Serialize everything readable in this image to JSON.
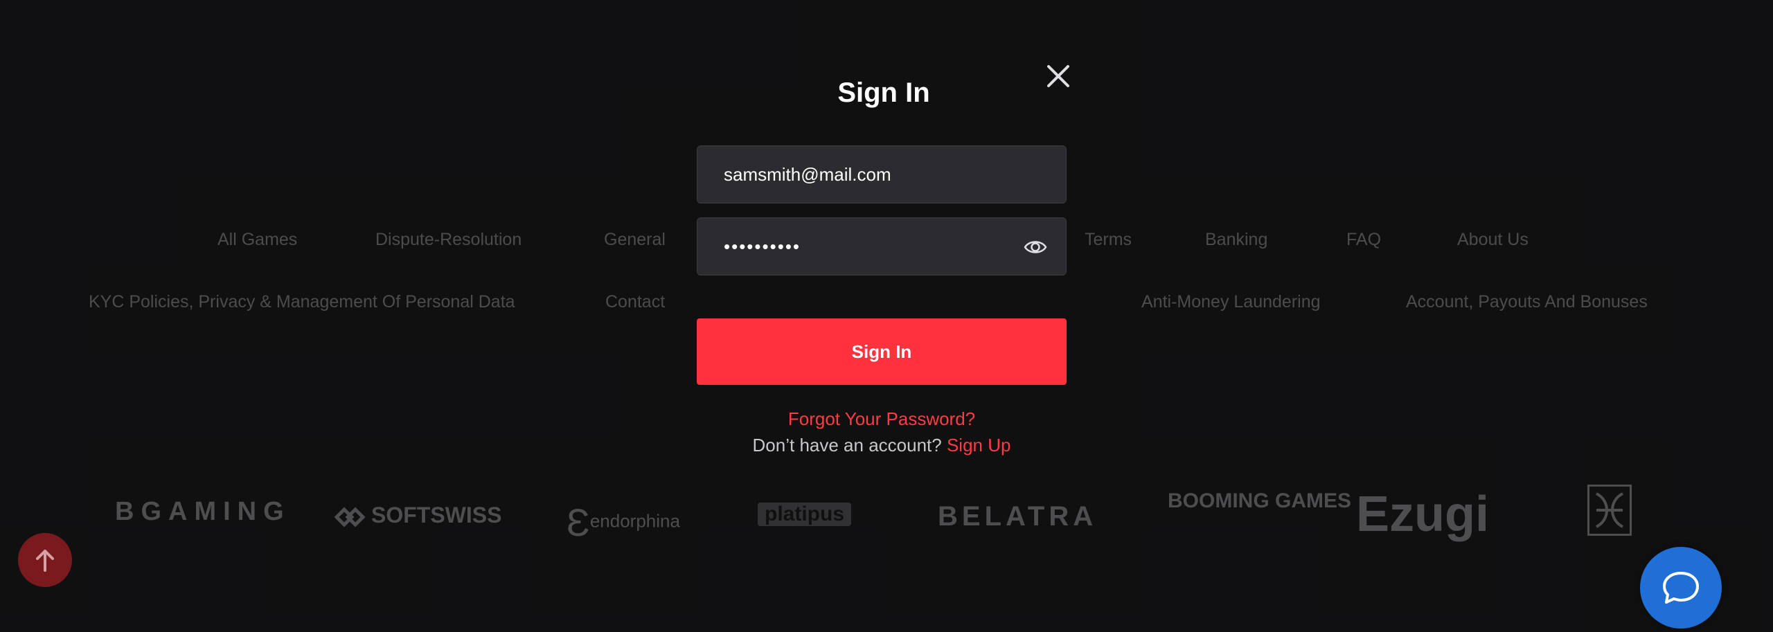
{
  "modal": {
    "title": "Sign In",
    "email_value": "samsmith@mail.com",
    "password_value": "••••••••••",
    "submit_label": "Sign In",
    "forgot_label": "Forgot Your Password?",
    "no_account_text": "Don’t have an account?",
    "signup_label": "Sign Up"
  },
  "footer": {
    "row1": [
      "All Games",
      "Dispute-Resolution",
      "General",
      "Terms",
      "Banking",
      "FAQ",
      "About Us"
    ],
    "row2": [
      "KYC Policies, Privacy & Management Of Personal Data",
      "Contact",
      "Anti-Money Laundering",
      "Account, Payouts And Bonuses"
    ]
  },
  "providers": [
    "BGAMING",
    "SOFTSWISS",
    "endorphina",
    "platipus",
    "BELATRA",
    "BOOMING GAMES",
    "Ezugi"
  ],
  "colors": {
    "accent": "#ff323e",
    "chat": "#1f6fd6",
    "background": "#1e1e20"
  },
  "icons": {
    "close": "close-icon",
    "eye": "eye-icon",
    "arrow_up": "arrow-up-icon",
    "chat": "chat-bubble-icon"
  }
}
